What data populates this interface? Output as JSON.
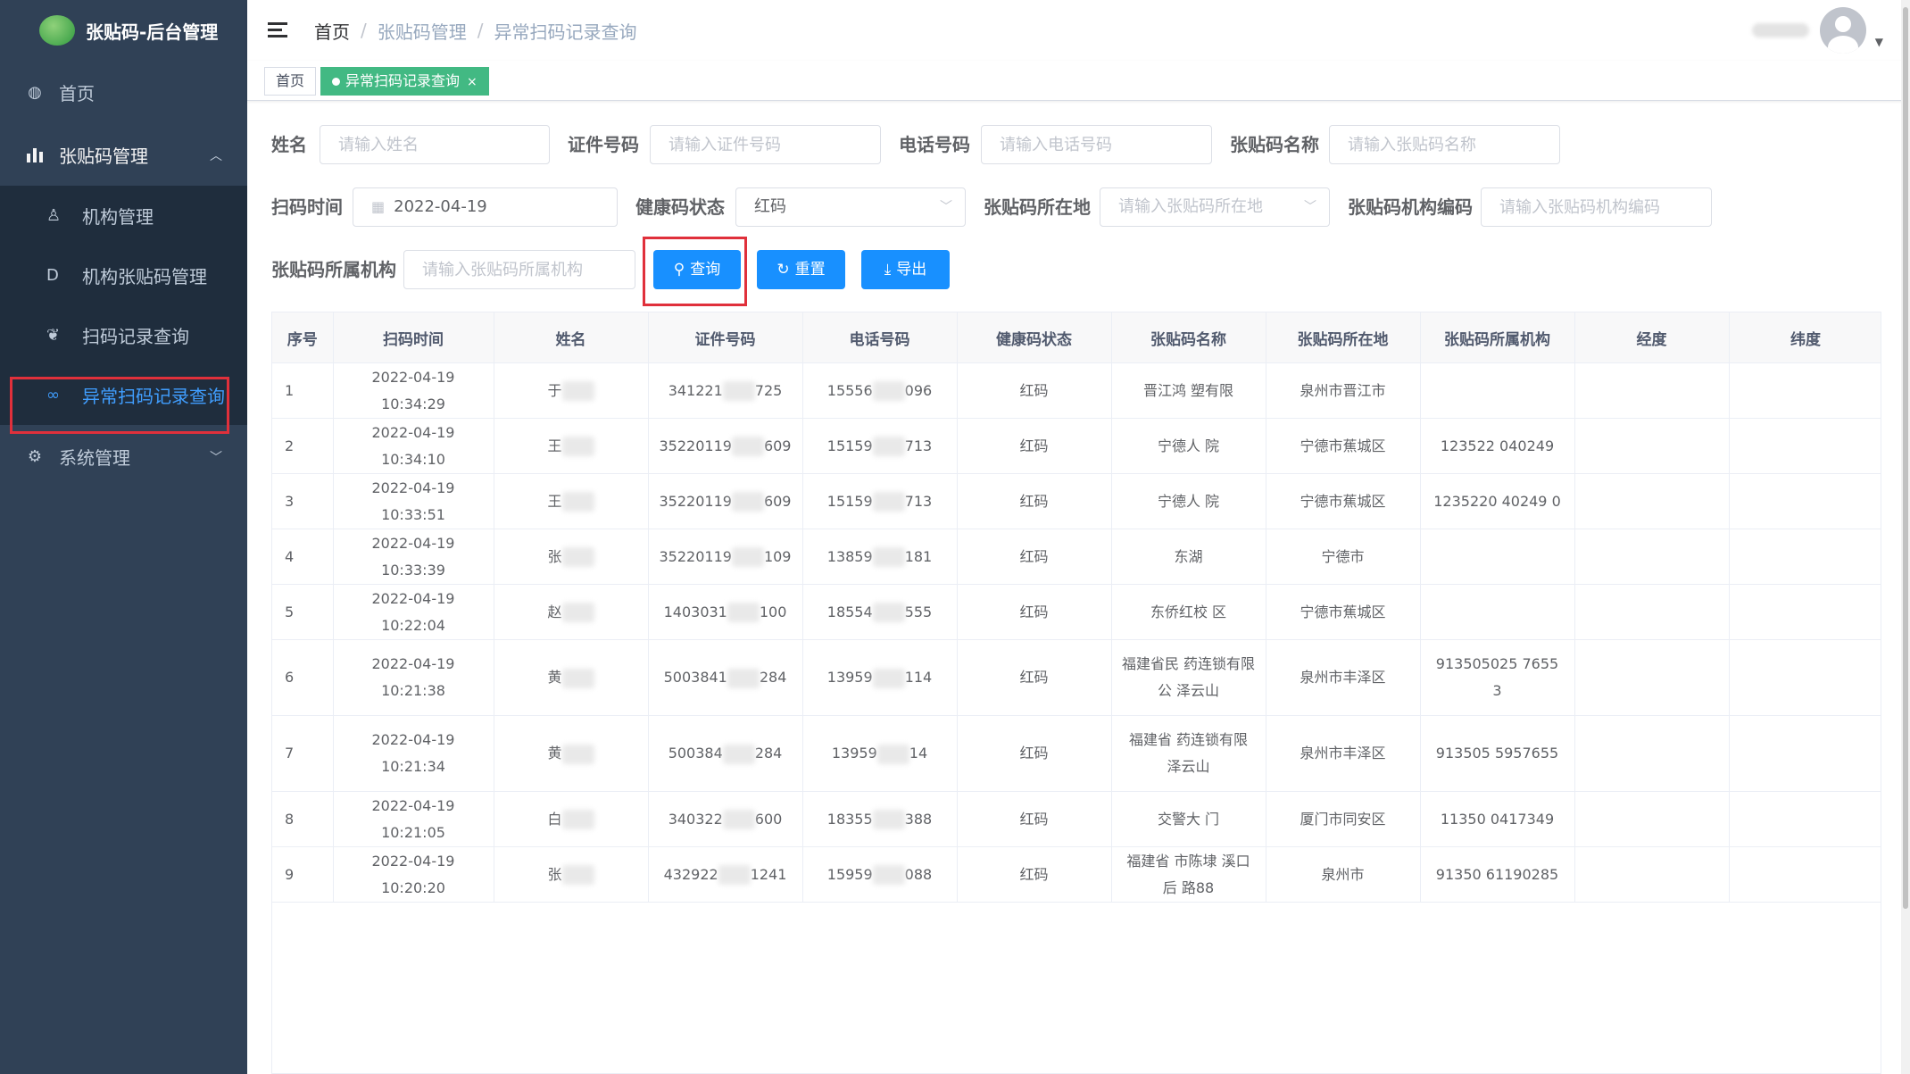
{
  "app": {
    "title": "张贴码-后台管理"
  },
  "sidebar": {
    "home": "首页",
    "qrcode_mgmt": "张贴码管理",
    "sub_items": [
      "机构管理",
      "机构张贴码管理",
      "扫码记录查询",
      "异常扫码记录查询"
    ],
    "system_mgmt": "系统管理"
  },
  "breadcrumb": {
    "home": "首页",
    "level1": "张贴码管理",
    "current": "异常扫码记录查询"
  },
  "tags": {
    "home": "首页",
    "active": "异常扫码记录查询"
  },
  "filters": {
    "name_label": "姓名",
    "name_placeholder": "请输入姓名",
    "id_label": "证件号码",
    "id_placeholder": "请输入证件号码",
    "phone_label": "电话号码",
    "phone_placeholder": "请输入电话号码",
    "code_name_label": "张贴码名称",
    "code_name_placeholder": "请输入张贴码名称",
    "scan_time_label": "扫码时间",
    "scan_time_value": "2022-04-19",
    "health_label": "健康码状态",
    "health_value": "红码",
    "location_label": "张贴码所在地",
    "location_placeholder": "请输入张贴码所在地",
    "org_code_label": "张贴码机构编码",
    "org_code_placeholder": "请输入张贴码机构编码",
    "org_label": "张贴码所属机构",
    "org_placeholder": "请输入张贴码所属机构"
  },
  "buttons": {
    "search": "查询",
    "reset": "重置",
    "export": "导出"
  },
  "table": {
    "headers": [
      "序号",
      "扫码时间",
      "姓名",
      "证件号码",
      "电话号码",
      "健康码状态",
      "张贴码名称",
      "张贴码所在地",
      "张贴码所属机构",
      "经度",
      "纬度"
    ],
    "rows": [
      {
        "idx": "1",
        "time": "2022-04-19 10:34:29",
        "name": "于",
        "id_a": "341221",
        "id_b": "725",
        "phone_a": "15556",
        "phone_b": "096",
        "health": "红码",
        "code_name": "晋江鸿 塑有限",
        "loc": "泉州市晋江市",
        "org": ""
      },
      {
        "idx": "2",
        "time": "2022-04-19 10:34:10",
        "name": "王",
        "id_a": "35220119",
        "id_b": "609",
        "phone_a": "15159",
        "phone_b": "713",
        "health": "红码",
        "code_name": "宁德人 院",
        "loc": "宁德市蕉城区",
        "org": "123522 040249"
      },
      {
        "idx": "3",
        "time": "2022-04-19 10:33:51",
        "name": "王",
        "id_a": "35220119",
        "id_b": "609",
        "phone_a": "15159",
        "phone_b": "713",
        "health": "红码",
        "code_name": "宁德人 院",
        "loc": "宁德市蕉城区",
        "org": "1235220 40249 0"
      },
      {
        "idx": "4",
        "time": "2022-04-19 10:33:39",
        "name": "张",
        "id_a": "35220119",
        "id_b": "109",
        "phone_a": "13859",
        "phone_b": "181",
        "health": "红码",
        "code_name": "东湖",
        "loc": "宁德市",
        "org": ""
      },
      {
        "idx": "5",
        "time": "2022-04-19 10:22:04",
        "name": "赵",
        "id_a": "1403031",
        "id_b": "100",
        "phone_a": "18554",
        "phone_b": "555",
        "health": "红码",
        "code_name": "东侨红校 区",
        "loc": "宁德市蕉城区",
        "org": ""
      },
      {
        "idx": "6",
        "time": "2022-04-19 10:21:38",
        "name": "黄",
        "id_a": "5003841",
        "id_b": "284",
        "phone_a": "13959",
        "phone_b": "114",
        "health": "红码",
        "code_name": "福建省民 药连锁有限公 泽云山",
        "loc": "泉州市丰泽区",
        "org": "913505025 7655 3"
      },
      {
        "idx": "7",
        "time": "2022-04-19 10:21:34",
        "name": "黄",
        "id_a": "500384",
        "id_b": "284",
        "phone_a": "13959",
        "phone_b": "14",
        "health": "红码",
        "code_name": "福建省 药连锁有限 泽云山",
        "loc": "泉州市丰泽区",
        "org": "913505 5957655"
      },
      {
        "idx": "8",
        "time": "2022-04-19 10:21:05",
        "name": "白",
        "id_a": "340322",
        "id_b": "600",
        "phone_a": "18355",
        "phone_b": "388",
        "health": "红码",
        "code_name": "交警大 门",
        "loc": "厦门市同安区",
        "org": "11350 0417349"
      },
      {
        "idx": "9",
        "time": "2022-04-19 10:20:20",
        "name": "张",
        "id_a": "432922",
        "id_b": "1241",
        "phone_a": "15959",
        "phone_b": "088",
        "health": "红码",
        "code_name": "福建省 市陈埭 溪口后 路88",
        "loc": "泉州市",
        "org": "91350 61190285"
      }
    ]
  },
  "colors": {
    "sidebar_bg": "#304156",
    "accent": "#409eff",
    "button": "#1890ff",
    "tag_active": "#42b983",
    "highlight": "#e0303b"
  }
}
